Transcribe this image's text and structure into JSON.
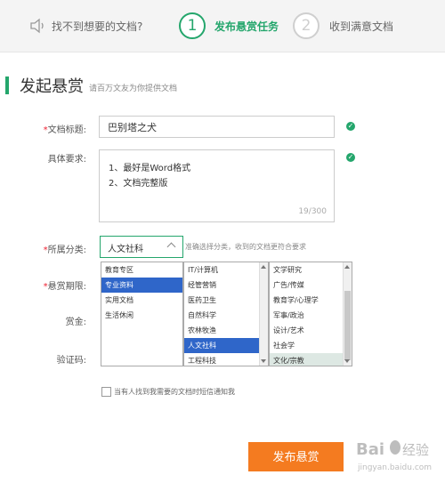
{
  "steps": {
    "hint": "找不到想要的文档?",
    "step1_num": "1",
    "step1_label": "发布悬赏任务",
    "step2_num": "2",
    "step2_label": "收到满意文档"
  },
  "page": {
    "title": "发起悬赏",
    "subtitle": "请百万文友为你提供文档"
  },
  "form": {
    "title_label": "文档标题:",
    "title_value": "巴别塔之犬",
    "req_label": "具体要求:",
    "req_line1": "1、最好是Word格式",
    "req_line2": "2、文档完整版",
    "req_counter": "19/300",
    "cat_label": "所属分类:",
    "cat_value": "人文社科",
    "cat_hint": "准确选择分类，收到的文档更符合要求",
    "period_label": "悬赏期限:",
    "reward_label": "赏金:",
    "captcha_label": "验证码:",
    "notify_label": "当有人找到我需要的文档时短信通知我",
    "submit_label": "发布悬赏"
  },
  "lists": {
    "col1": [
      "教育专区",
      "专业资料",
      "实用文档",
      "生活休闲"
    ],
    "col2": [
      "IT/计算机",
      "经管营销",
      "医药卫生",
      "自然科学",
      "农林牧渔",
      "人文社科",
      "工程科技"
    ],
    "col3": [
      "文学研究",
      "广告/传媒",
      "教育学/心理学",
      "军事/政治",
      "设计/艺术",
      "社会学",
      "文化/宗教"
    ]
  },
  "watermark": {
    "text1": "Bai",
    "text2": "经验",
    "text3": "jingyan.baidu.com"
  },
  "colors": {
    "accent": "#24a66c",
    "submit": "#f47b20",
    "selected": "#2f66c9"
  }
}
